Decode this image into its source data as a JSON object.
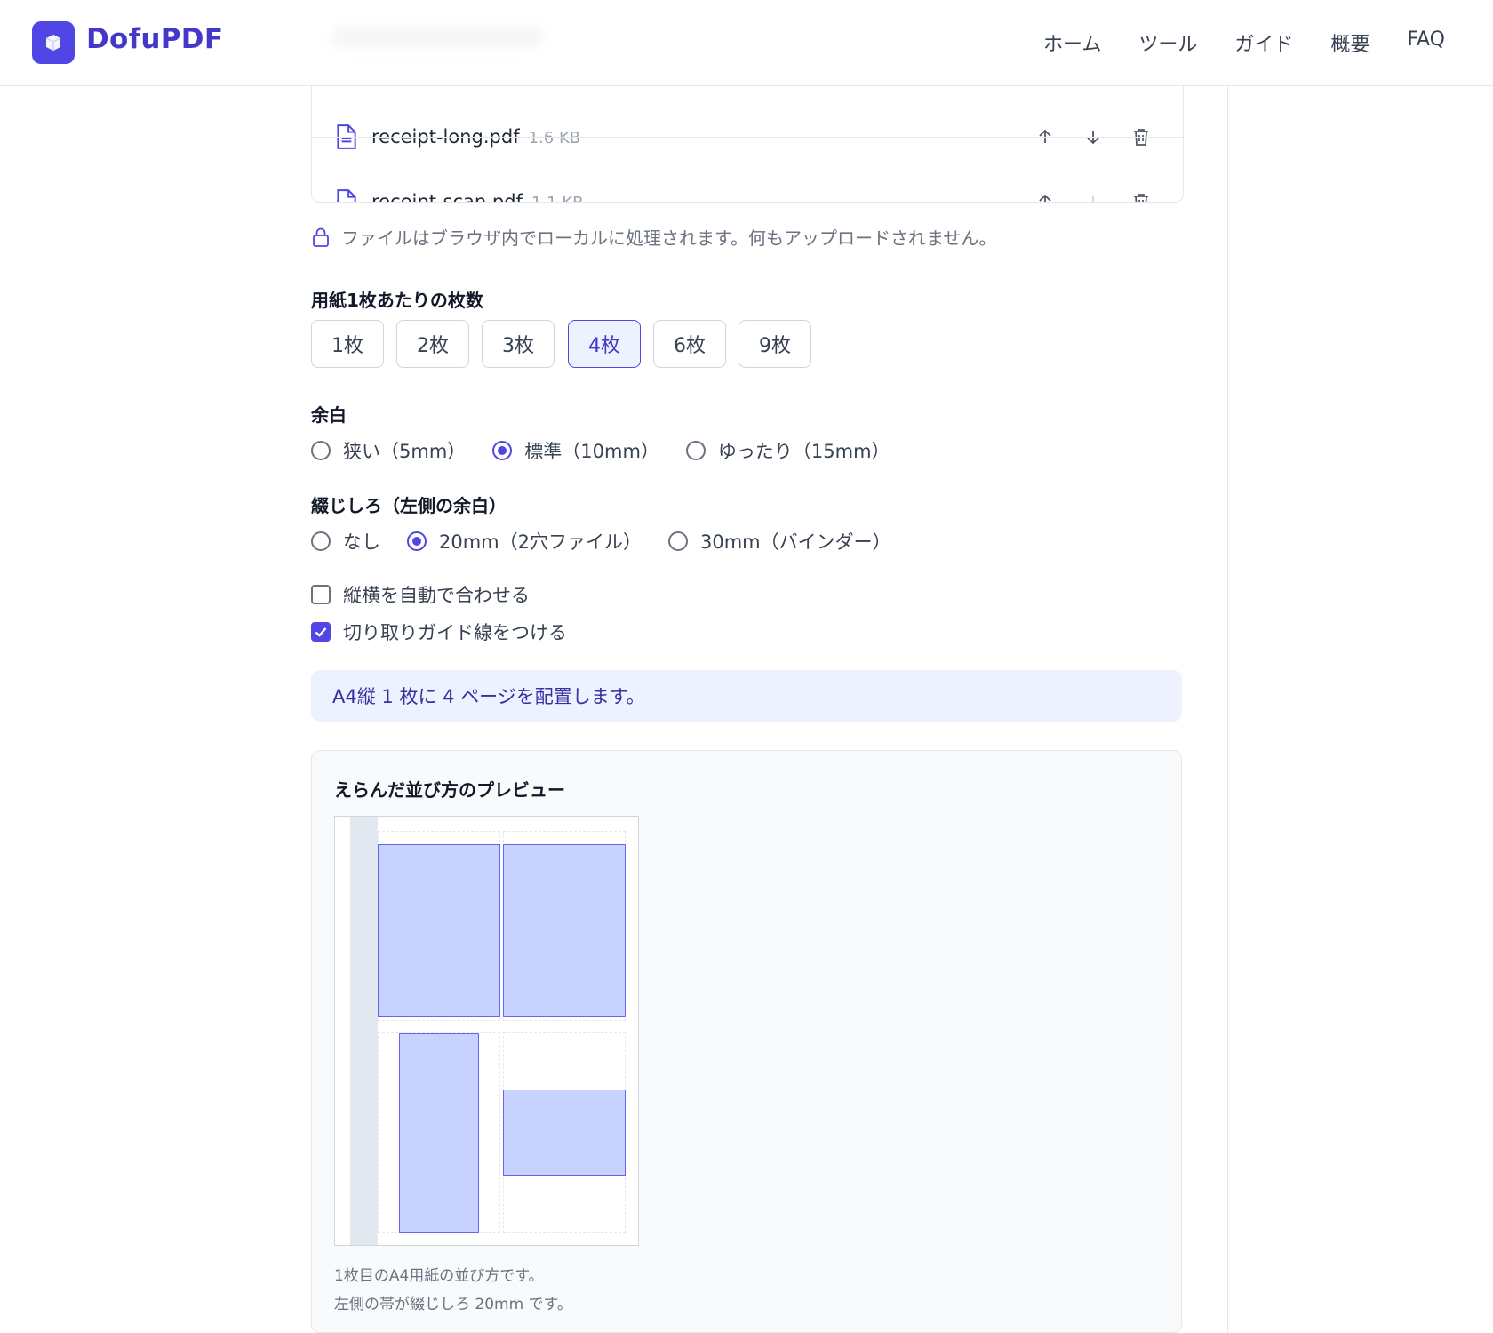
{
  "header": {
    "brand": "DofuPDF",
    "nav": [
      "ホーム",
      "ツール",
      "ガイド",
      "概要",
      "FAQ"
    ]
  },
  "files": [
    {
      "name": "receipt-long.pdf",
      "size": "1.6 KB",
      "down_enabled": true
    },
    {
      "name": "receipt-scan.pdf",
      "size": "1.1 KB",
      "down_enabled": false
    }
  ],
  "privacy_note": "ファイルはブラウザ内でローカルに処理されます。何もアップロードされません。",
  "pages_per_sheet": {
    "title": "用紙1枚あたりの枚数",
    "options": [
      "1枚",
      "2枚",
      "3枚",
      "4枚",
      "6枚",
      "9枚"
    ],
    "selected": "4枚"
  },
  "margin": {
    "title": "余白",
    "options": [
      "狭い（5mm）",
      "標準（10mm）",
      "ゆったり（15mm）"
    ],
    "selected": "標準（10mm）"
  },
  "binding_margin": {
    "title": "綴じしろ（左側の余白）",
    "options": [
      "なし",
      "20mm（2穴ファイル）",
      "30mm（バインダー）"
    ],
    "selected": "20mm（2穴ファイル）"
  },
  "checkboxes": [
    {
      "label": "縦横を自動で合わせる",
      "checked": false
    },
    {
      "label": "切り取りガイド線をつける",
      "checked": true
    }
  ],
  "info": "A4縦 1 枚に 4 ページを配置します。",
  "preview": {
    "title": "えらんだ並び方のプレビュー",
    "caption1": "1枚目のA4用紙の並び方です。",
    "caption2": "左側の帯が綴じしろ 20mm です。"
  },
  "colors": {
    "accent": "#4f46e5",
    "brand": "#4338ca",
    "page_fill": "#c7d2fe"
  }
}
